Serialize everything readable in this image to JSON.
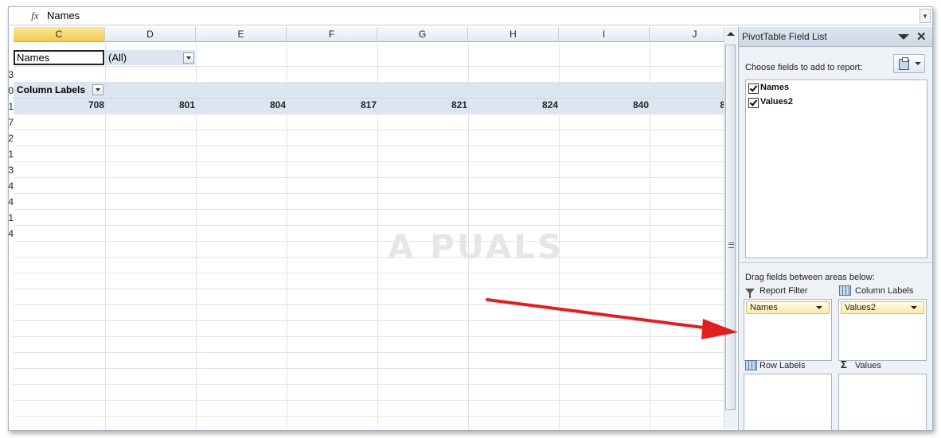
{
  "formula_bar": {
    "fx_label": "fx",
    "value": "Names"
  },
  "grid": {
    "columns": [
      "C",
      "D",
      "E",
      "F",
      "G",
      "H",
      "I",
      "J"
    ],
    "selected_column": "C",
    "row_numbers": [
      "3",
      "0",
      "1",
      "7",
      "2",
      "1",
      "3",
      "4",
      "4",
      "1",
      "4"
    ],
    "cells": {
      "c_names": "Names",
      "d_all": "(All)",
      "column_labels": "Column Labels"
    },
    "values_row": [
      "708",
      "801",
      "804",
      "817",
      "821",
      "824",
      "840",
      "8"
    ]
  },
  "watermark": "A  PUALS",
  "pivot_panel": {
    "title": "PivotTable Field List",
    "choose_text": "Choose fields to add to report:",
    "fields": [
      {
        "label": "Names",
        "checked": true
      },
      {
        "label": "Values2",
        "checked": true
      }
    ],
    "drag_text": "Drag fields between areas below:",
    "areas": {
      "report_filter": {
        "label": "Report Filter",
        "items": [
          "Names"
        ]
      },
      "column_labels": {
        "label": "Column Labels",
        "items": [
          "Values2"
        ]
      },
      "row_labels": {
        "label": "Row Labels",
        "items": []
      },
      "values": {
        "label": "Values",
        "items": []
      }
    }
  },
  "colors": {
    "selected_header": "#f6c951",
    "pivot_band": "#dce6f1",
    "arrow": "#e02020",
    "pill": "#fde9a8"
  }
}
